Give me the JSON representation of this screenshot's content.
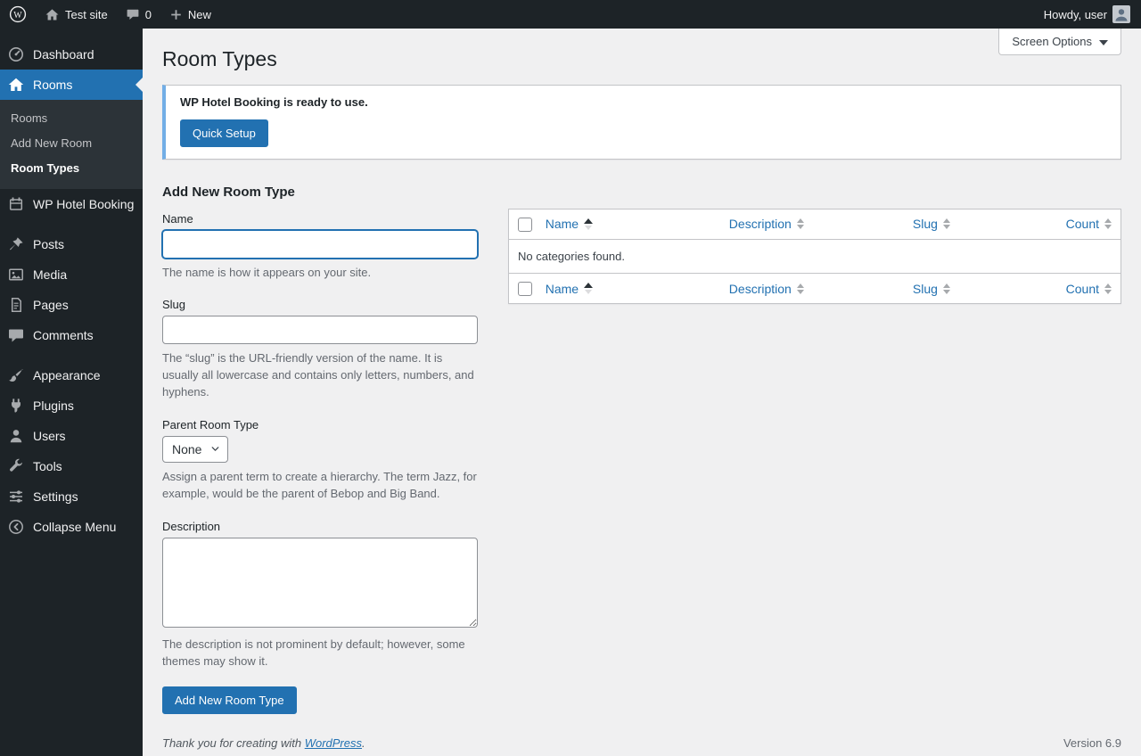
{
  "colors": {
    "accent": "#2271b1",
    "notice_border": "#72aee6",
    "sidebar_bg": "#1d2327",
    "content_bg": "#f0f0f1"
  },
  "admin_bar": {
    "site_name": "Test site",
    "comments_count": "0",
    "new_label": "New",
    "howdy": "Howdy, user"
  },
  "sidebar": {
    "items": [
      {
        "label": "Dashboard",
        "icon": "dashboard-icon"
      },
      {
        "label": "Rooms",
        "icon": "rooms-icon",
        "active": true
      },
      {
        "label": "WP Hotel Booking",
        "icon": "hotel-booking-icon"
      },
      {
        "label": "Posts",
        "icon": "posts-icon"
      },
      {
        "label": "Media",
        "icon": "media-icon"
      },
      {
        "label": "Pages",
        "icon": "pages-icon"
      },
      {
        "label": "Comments",
        "icon": "comments-icon"
      },
      {
        "label": "Appearance",
        "icon": "appearance-icon"
      },
      {
        "label": "Plugins",
        "icon": "plugins-icon"
      },
      {
        "label": "Users",
        "icon": "users-icon"
      },
      {
        "label": "Tools",
        "icon": "tools-icon"
      },
      {
        "label": "Settings",
        "icon": "settings-icon"
      },
      {
        "label": "Collapse Menu",
        "icon": "collapse-icon"
      }
    ],
    "submenu": [
      {
        "label": "Rooms"
      },
      {
        "label": "Add New Room"
      },
      {
        "label": "Room Types",
        "current": true
      }
    ]
  },
  "page": {
    "title": "Room Types",
    "screen_options_label": "Screen Options",
    "notice": {
      "message": "WP Hotel Booking is ready to use.",
      "button_label": "Quick Setup"
    },
    "form": {
      "heading": "Add New Room Type",
      "name_label": "Name",
      "name_value": "",
      "name_help": "The name is how it appears on your site.",
      "slug_label": "Slug",
      "slug_value": "",
      "slug_help": "The “slug” is the URL-friendly version of the name. It is usually all lowercase and contains only letters, numbers, and hyphens.",
      "parent_label": "Parent Room Type",
      "parent_value": "None",
      "parent_help": "Assign a parent term to create a hierarchy. The term Jazz, for example, would be the parent of Bebop and Big Band.",
      "description_label": "Description",
      "description_value": "",
      "description_help": "The description is not prominent by default; however, some themes may show it.",
      "submit_label": "Add New Room Type"
    },
    "table": {
      "columns": [
        "Name",
        "Description",
        "Slug",
        "Count"
      ],
      "empty_message": "No categories found."
    },
    "footer": {
      "thanks_prefix": "Thank you for creating with ",
      "link_label": "WordPress",
      "suffix": ".",
      "version": "Version 6.9"
    }
  }
}
